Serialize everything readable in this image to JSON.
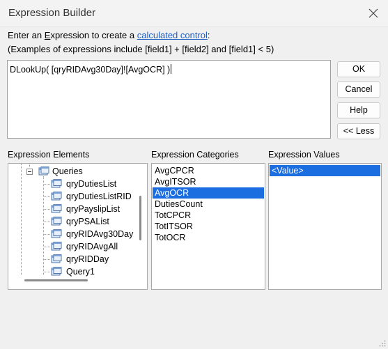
{
  "window": {
    "title": "Expression Builder"
  },
  "instructions": {
    "line1_prefix": "Enter an ",
    "line1_mnemonic": "E",
    "line1_middle": "xpression to create a ",
    "line1_link": "calculated control",
    "line1_suffix": ":",
    "line2": "(Examples of expressions include [field1] + [field2] and [field1] < 5)"
  },
  "expression": {
    "value": "DLookUp( [qryRIDAvg30Day]![AvgOCR] )"
  },
  "buttons": {
    "ok": "OK",
    "cancel": "Cancel",
    "help": "Help",
    "less": "<< Less"
  },
  "elements": {
    "label": "Expression Elements",
    "root": "Queries",
    "items": [
      "qryDutiesList",
      "qryDutiesListRID",
      "qryPayslipList",
      "qryPSAList",
      "qryRIDAvg30Day",
      "qryRIDAvgAll",
      "qryRIDDay",
      "Query1"
    ]
  },
  "categories": {
    "label": "Expression Categories",
    "items": [
      "AvgCPCR",
      "AvgITSOR",
      "AvgOCR",
      "DutiesCount",
      "TotCPCR",
      "TotITSOR",
      "TotOCR"
    ],
    "selected": "AvgOCR"
  },
  "values": {
    "label": "Expression Values",
    "items": [
      "<Value>"
    ],
    "selected": "<Value>"
  },
  "colors": {
    "selection": "#1b6ee0",
    "link": "#1f5ec2"
  },
  "icons": {
    "close": "close-icon",
    "query": "query-icon",
    "expander": "collapse-icon"
  }
}
